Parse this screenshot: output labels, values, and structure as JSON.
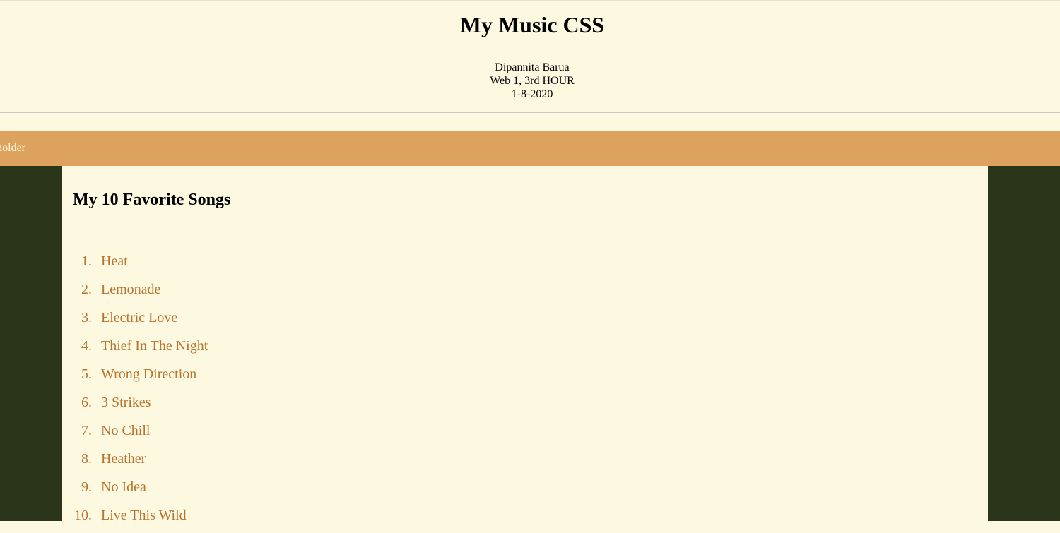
{
  "header": {
    "title": "My Music CSS",
    "author": "Dipannita Barua",
    "course": "Web 1, 3rd HOUR",
    "date": "1-8-2020"
  },
  "nav": {
    "item_label": "holder"
  },
  "main": {
    "heading": "My 10 Favorite Songs",
    "songs": [
      {
        "number": "1.",
        "title": "Heat"
      },
      {
        "number": "2.",
        "title": "Lemonade"
      },
      {
        "number": "3.",
        "title": "Electric Love"
      },
      {
        "number": "4.",
        "title": "Thief In The Night"
      },
      {
        "number": "5.",
        "title": "Wrong Direction"
      },
      {
        "number": "6.",
        "title": "3 Strikes"
      },
      {
        "number": "7.",
        "title": "No Chill"
      },
      {
        "number": "8.",
        "title": "Heather"
      },
      {
        "number": "9.",
        "title": "No Idea"
      },
      {
        "number": "10.",
        "title": "Live This Wild"
      }
    ]
  },
  "colors": {
    "page_background": "#fdf9e1",
    "nav_background": "#dca25e",
    "sidebar_background": "#2a3519",
    "song_text": "#b8732e"
  }
}
